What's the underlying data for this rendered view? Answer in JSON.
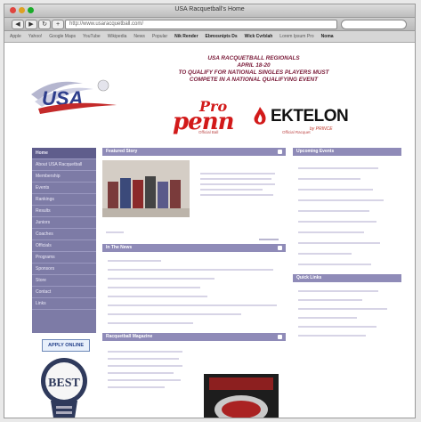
{
  "window": {
    "title": "USA Racquetball's Home",
    "url": "http://www.usaracquetball.com/",
    "traffic_colors": [
      "#e0443e",
      "#dea123",
      "#1aab29"
    ]
  },
  "toolbar": {
    "back_label": "◀",
    "forward_label": "▶"
  },
  "bookmarks": [
    "Apple",
    "Yahoo!",
    "Google Maps",
    "YouTube",
    "Wikipedia",
    "News",
    "Popular",
    "Nik Render",
    "Ebmxsnipts Ds",
    "Wick Cvrblah",
    "Lorem Ipsum Pro",
    "Noma"
  ],
  "header": {
    "line1": "USA RACQUETBALL REGIONALS",
    "line2": "APRIL 18-20",
    "line3": "TO QUALIFY FOR NATIONAL SINGLES PLAYERS MUST",
    "line4": "COMPETE IN A NATIONAL QUALIFYING EVENT"
  },
  "sponsors": {
    "pro": "Pro",
    "penn": "penn",
    "ektelon": "EKTELON",
    "ektelon_sub": "by PRINCE",
    "caption_left": "Official Ball",
    "caption_right": "Official Racquet"
  },
  "leftnav": {
    "items": [
      "Home",
      "About USA Racquetball",
      "Membership",
      "Events",
      "Rankings",
      "Results",
      "Juniors",
      "Coaches",
      "Officials",
      "Programs",
      "Sponsors",
      "Store",
      "Contact",
      "Links"
    ]
  },
  "badges": {
    "apply_online": "APPLY ONLINE",
    "best": "BEST"
  },
  "panels": {
    "featured": "Featured Story",
    "events": "Upcoming Events",
    "news": "In The News",
    "magazine": "Racquetball Magazine",
    "links": "Quick Links"
  }
}
